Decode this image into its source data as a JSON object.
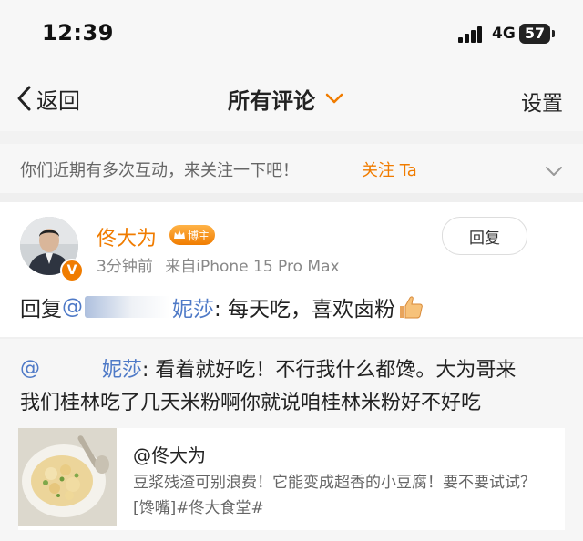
{
  "status_bar": {
    "time": "12:39",
    "network": "4G",
    "battery": "57"
  },
  "nav": {
    "back_label": "返回",
    "title": "所有评论",
    "settings_label": "设置"
  },
  "follow_prompt": {
    "text": "你们近期有多次互动，来关注一下吧！",
    "link_label": "关注 Ta"
  },
  "comment": {
    "username": "佟大为",
    "badge_label": "博主",
    "verified_mark": "V",
    "time": "3分钟前",
    "source": "来自iPhone 15 Pro Max",
    "reply_button_label": "回复",
    "body_prefix": "回复",
    "body_mention_start": "@",
    "body_mention_name": "妮莎",
    "body_text": ": 每天吃，喜欢卤粉"
  },
  "quoted": {
    "mention_start": "@",
    "mention_name": "妮莎",
    "text_line1": ": 看着就好吃！不行我什么都馋。大为哥来",
    "text_line2": "我们桂林吃了几天米粉啊你就说咱桂林米粉好不好吃"
  },
  "original_post": {
    "author": "@佟大为",
    "text": "豆浆残渣可别浪费！它能变成超香的小豆腐！要不要试试？[馋嘴]",
    "topic": "#佟大食堂#"
  },
  "colors": {
    "accent": "#f07c00",
    "link": "#4f7ac7",
    "muted": "#888888"
  },
  "icons": {
    "back": "chevron-left-icon",
    "title_dropdown": "chevron-down-icon",
    "collapse": "chevron-down-icon",
    "thumb": "thumbs-up-icon",
    "badge": "crown-icon"
  }
}
